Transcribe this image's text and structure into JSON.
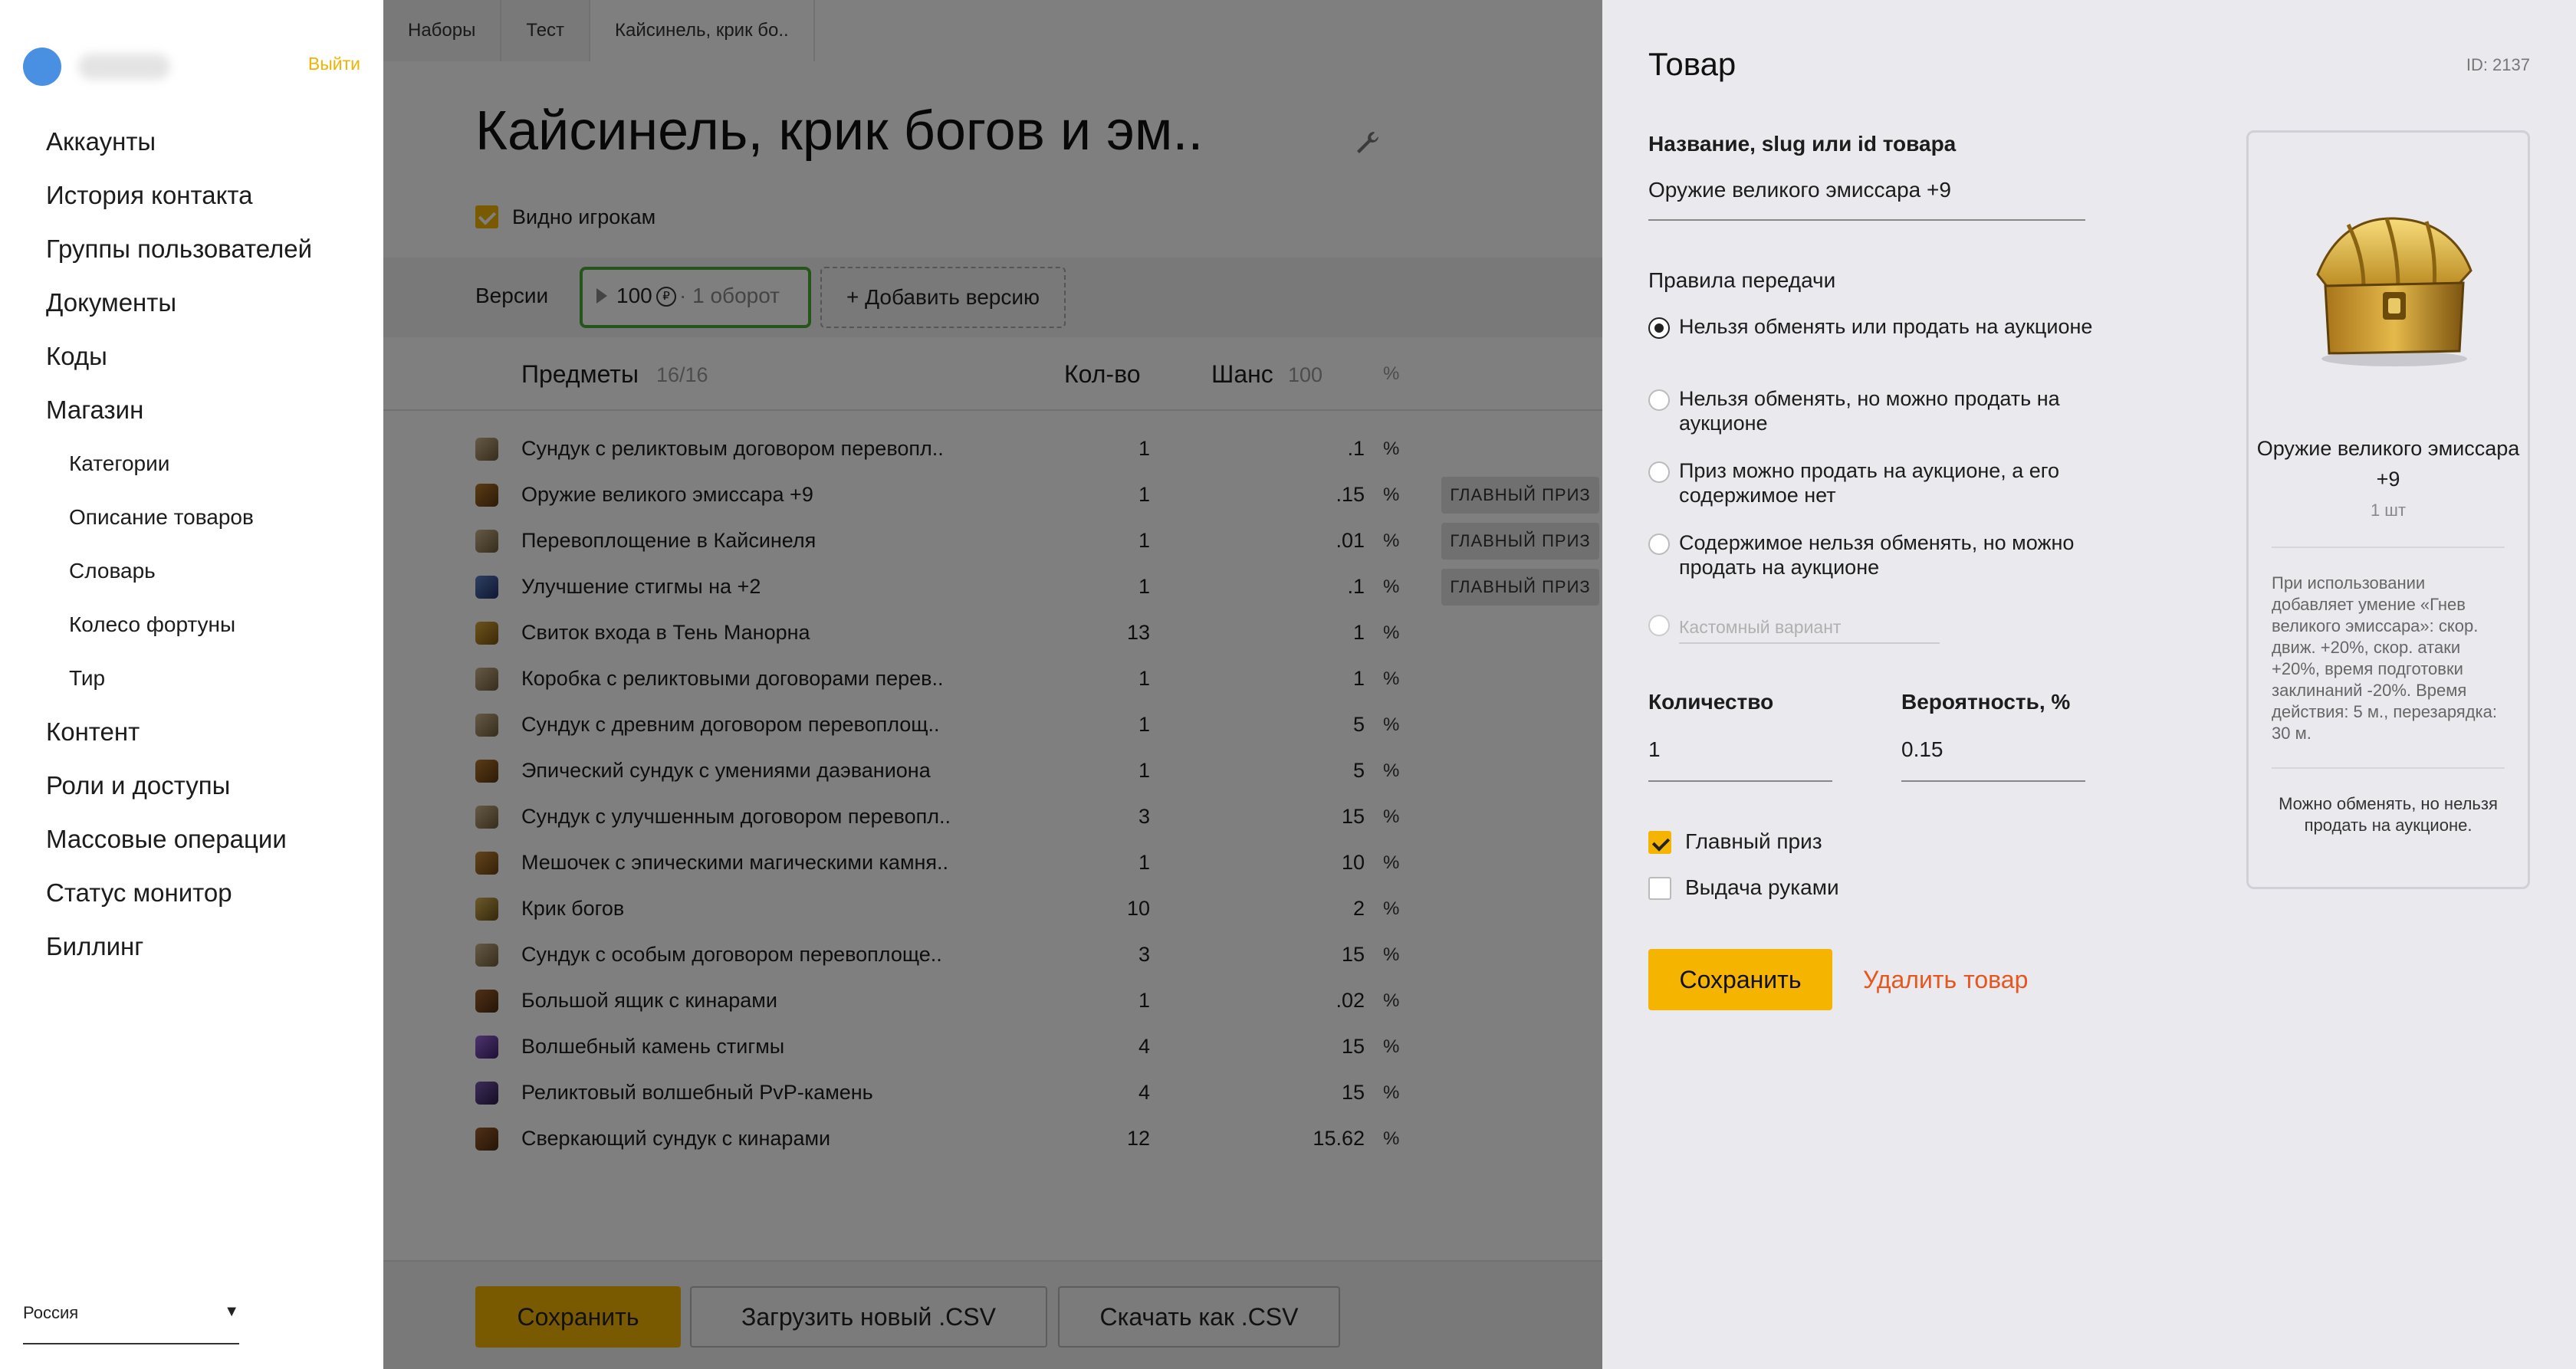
{
  "sidebar": {
    "logout": "Выйти",
    "items": [
      {
        "label": "Аккаунты",
        "level": 0
      },
      {
        "label": "История контакта",
        "level": 0
      },
      {
        "label": "Группы пользователей",
        "level": 0
      },
      {
        "label": "Документы",
        "level": 0
      },
      {
        "label": "Коды",
        "level": 0
      },
      {
        "label": "Магазин",
        "level": 0
      },
      {
        "label": "Категории",
        "level": 1
      },
      {
        "label": "Описание товаров",
        "level": 1
      },
      {
        "label": "Словарь",
        "level": 1
      },
      {
        "label": "Колесо фортуны",
        "level": 1
      },
      {
        "label": "Тир",
        "level": 1
      },
      {
        "label": "Контент",
        "level": 0
      },
      {
        "label": "Роли и доступы",
        "level": 0
      },
      {
        "label": "Массовые операции",
        "level": 0
      },
      {
        "label": "Статус монитор",
        "level": 0
      },
      {
        "label": "Биллинг",
        "level": 0
      }
    ],
    "region": "Россия"
  },
  "main": {
    "breadcrumbs": [
      "Наборы",
      "Тест",
      "Кайсинель, крик бо.."
    ],
    "title": "Кайсинель, крик богов и эм..",
    "visible_label": "Видно игрокам",
    "versions_label": "Версии",
    "version": {
      "amount": "100",
      "currency": "₽",
      "turns": "· 1 оборот"
    },
    "add_version": "+ Добавить версию",
    "table": {
      "col_items": "Предметы",
      "items_count": "16/16",
      "col_qty": "Кол-во",
      "col_chance": "Шанс",
      "chance_total": "100",
      "col_pct": "%",
      "rows": [
        {
          "icon": "scroll",
          "name": "Сундук с реликтовым договором перевопл..",
          "qty": "1",
          "chance": ".1",
          "pct": "%",
          "badge": ""
        },
        {
          "icon": "chest",
          "name": "Оружие великого эмиссара +9",
          "qty": "1",
          "chance": ".15",
          "pct": "%",
          "badge": "ГЛАВНЫЙ ПРИЗ"
        },
        {
          "icon": "scroll",
          "name": "Перевоплощение в Кайсинеля",
          "qty": "1",
          "chance": ".01",
          "pct": "%",
          "badge": "ГЛАВНЫЙ ПРИЗ"
        },
        {
          "icon": "gem",
          "name": "Улучшение стигмы на +2",
          "qty": "1",
          "chance": ".1",
          "pct": "%",
          "badge": "ГЛАВНЫЙ ПРИЗ"
        },
        {
          "icon": "scroll-gold",
          "name": "Свиток входа в Тень Манорна",
          "qty": "13",
          "chance": "1",
          "pct": "%",
          "badge": ""
        },
        {
          "icon": "scroll",
          "name": "Коробка с реликтовыми договорами перев..",
          "qty": "1",
          "chance": "1",
          "pct": "%",
          "badge": ""
        },
        {
          "icon": "scroll",
          "name": "Сундук с древним договором перевоплощ..",
          "qty": "1",
          "chance": "5",
          "pct": "%",
          "badge": ""
        },
        {
          "icon": "chest",
          "name": "Эпический сундук с умениями даэваниона",
          "qty": "1",
          "chance": "5",
          "pct": "%",
          "badge": ""
        },
        {
          "icon": "scroll",
          "name": "Сундук с улучшенным договором перевопл..",
          "qty": "3",
          "chance": "15",
          "pct": "%",
          "badge": ""
        },
        {
          "icon": "bag",
          "name": "Мешочек с эпическими магическими камня..",
          "qty": "1",
          "chance": "10",
          "pct": "%",
          "badge": ""
        },
        {
          "icon": "horn",
          "name": "Крик богов",
          "qty": "10",
          "chance": "2",
          "pct": "%",
          "badge": ""
        },
        {
          "icon": "scroll",
          "name": "Сундук с особым договором перевоплоще..",
          "qty": "3",
          "chance": "15",
          "pct": "%",
          "badge": ""
        },
        {
          "icon": "box",
          "name": "Большой ящик с кинарами",
          "qty": "1",
          "chance": ".02",
          "pct": "%",
          "badge": ""
        },
        {
          "icon": "stone",
          "name": "Волшебный камень стигмы",
          "qty": "4",
          "chance": "15",
          "pct": "%",
          "badge": ""
        },
        {
          "icon": "stone-dark",
          "name": "Реликтовый волшебный PvP-камень",
          "qty": "4",
          "chance": "15",
          "pct": "%",
          "badge": ""
        },
        {
          "icon": "box",
          "name": "Сверкающий сундук с кинарами",
          "qty": "12",
          "chance": "15.62",
          "pct": "%",
          "badge": ""
        }
      ]
    },
    "footer": {
      "save": "Сохранить",
      "upload": "Загрузить новый .CSV",
      "download": "Скачать как .CSV"
    }
  },
  "panel": {
    "title": "Товар",
    "id": "ID: 2137",
    "name_label": "Название, slug или id товара",
    "name_value": "Оружие великого эмиссара +9",
    "rules_label": "Правила передачи",
    "rules": [
      {
        "label": "Нельзя обменять или продать на аукционе",
        "selected": true
      },
      {
        "label": "Нельзя обменять, но можно продать на аукционе",
        "selected": false
      },
      {
        "label": "Приз можно продать на аукционе, а его содержимое нет",
        "selected": false
      },
      {
        "label": "Содержимое нельзя обменять, но можно продать на аукционе",
        "selected": false
      }
    ],
    "custom_placeholder": "Кастомный вариант",
    "qty_label": "Количество",
    "qty_value": "1",
    "prob_label": "Вероятность, %",
    "prob_value": "0.15",
    "main_prize_label": "Главный приз",
    "main_prize_checked": true,
    "manual_label": "Выдача руками",
    "manual_checked": false,
    "save": "Сохранить",
    "delete": "Удалить товар",
    "card": {
      "name": "Оружие великого эмиссара +9",
      "count": "1 шт",
      "description": "При использовании добавляет умение «Гнев великого эмиссара»: скор. движ. +20%, скор. атаки +20%, время подготовки заклинаний -20%. Время действия: 5 м., перезарядка: 30 м.",
      "note": "Можно обменять, но нельзя продать на аукционе."
    }
  },
  "colors": {
    "accent": "#f5b400",
    "version_border": "#4caa39",
    "delete": "#e8561f",
    "avatar": "#4a90e2"
  }
}
